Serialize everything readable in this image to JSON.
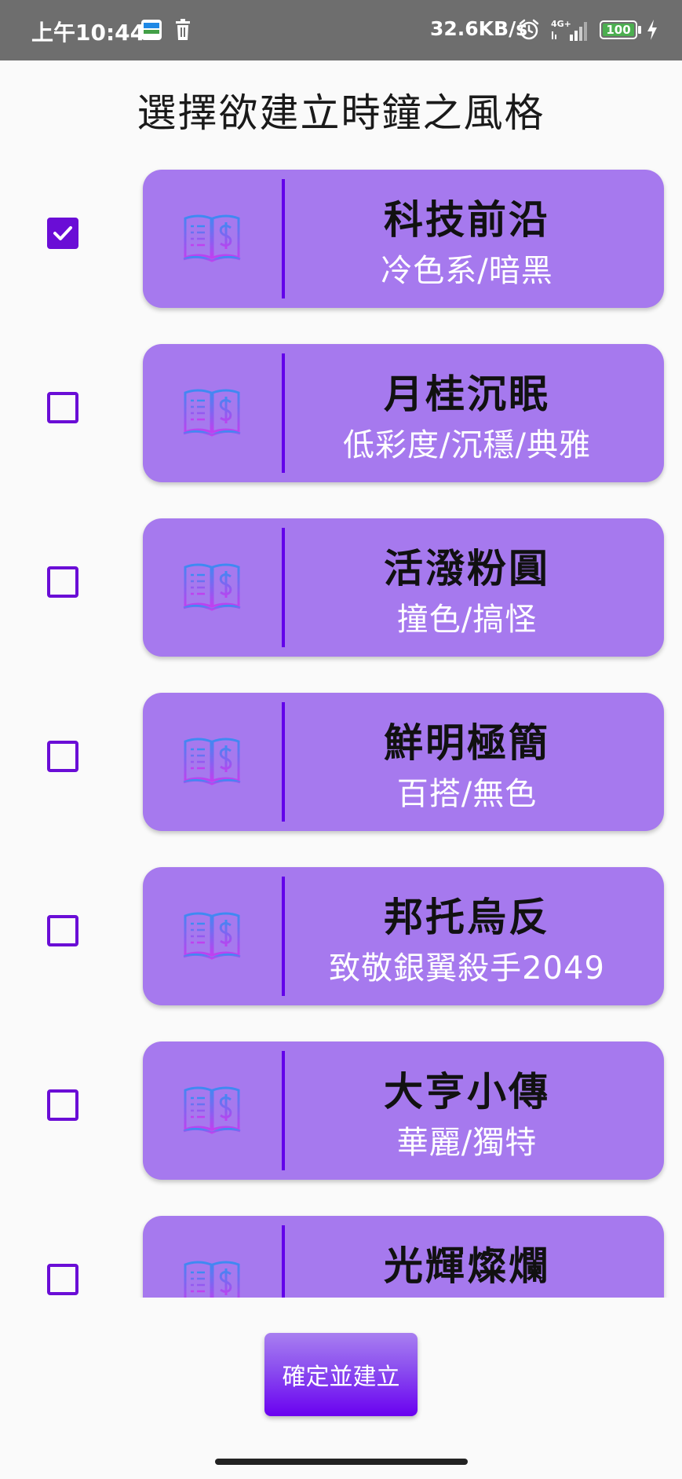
{
  "status_bar": {
    "time": "上午10:44",
    "network_speed": "32.6KB/s",
    "network_type": "4G+",
    "battery_level": "100",
    "icons": [
      "app-icon",
      "trash-icon",
      "alarm-icon",
      "signal-icon",
      "battery-icon",
      "charging-icon"
    ]
  },
  "page": {
    "title": "選擇欲建立時鐘之風格"
  },
  "styles": [
    {
      "name": "科技前沿",
      "description": "冷色系/暗黑",
      "checked": true
    },
    {
      "name": "月桂沉眠",
      "description": "低彩度/沉穩/典雅",
      "checked": false
    },
    {
      "name": "活潑粉圓",
      "description": "撞色/搞怪",
      "checked": false
    },
    {
      "name": "鮮明極簡",
      "description": "百搭/無色",
      "checked": false
    },
    {
      "name": "邦托烏反",
      "description": "致敬銀翼殺手2049",
      "checked": false
    },
    {
      "name": "大亨小傳",
      "description": "華麗/獨特",
      "checked": false
    },
    {
      "name": "光輝燦爛",
      "description": "",
      "checked": false
    }
  ],
  "card_icon": "book-dollar-icon",
  "confirm_button": {
    "label": "確定並建立"
  },
  "colors": {
    "card_background": "#a679ee",
    "accent": "#6a0dd6",
    "divider": "#6200ea",
    "status_bar": "#6e6e6e"
  }
}
